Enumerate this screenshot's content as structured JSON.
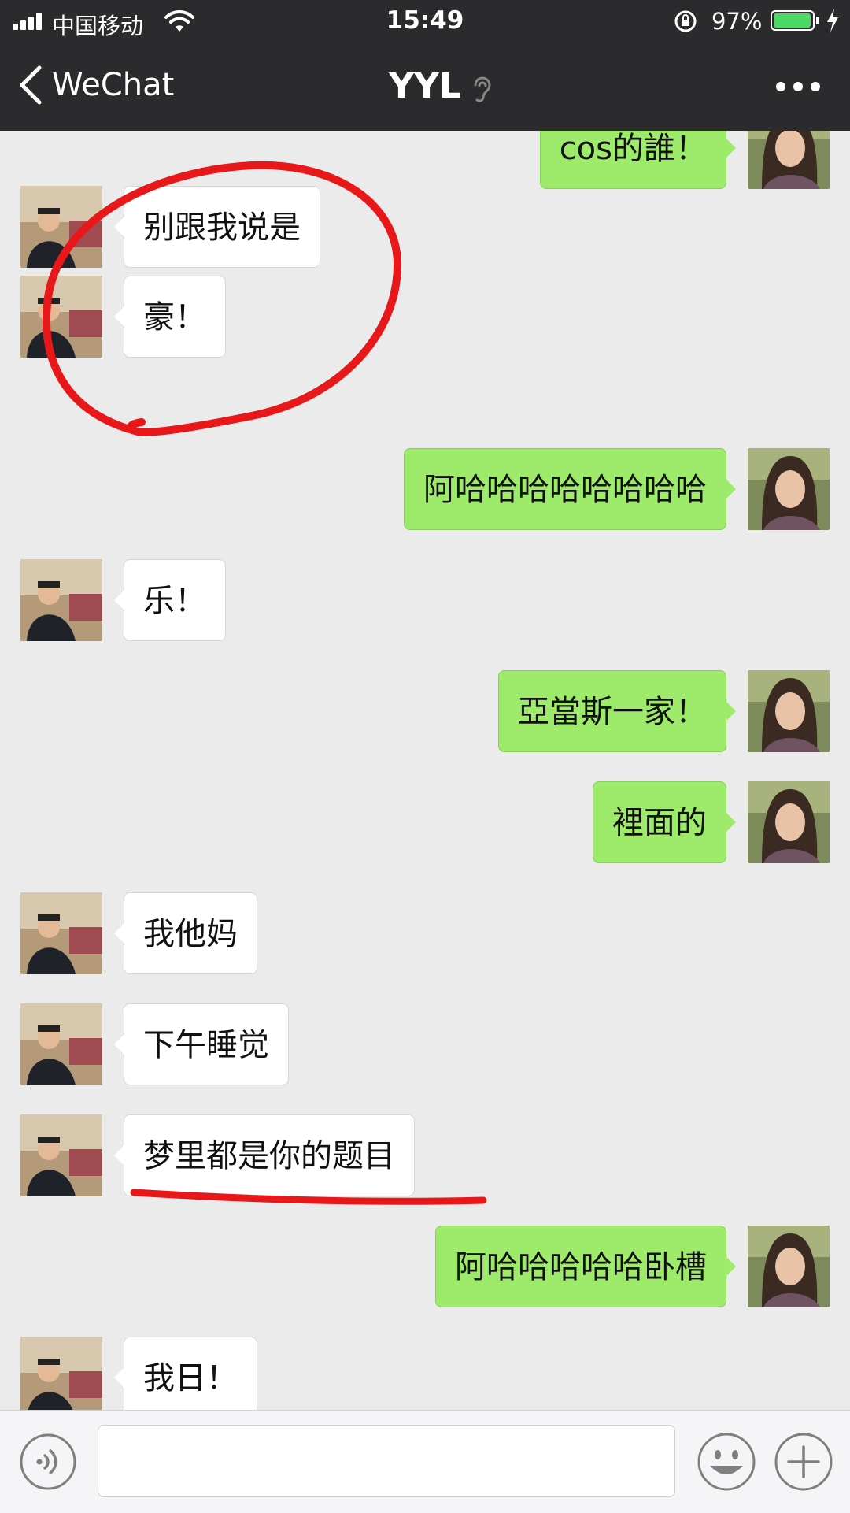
{
  "status_bar": {
    "carrier": "中国移动",
    "time": "15:49",
    "battery_percent": "97%",
    "battery_level": 0.97,
    "icons": [
      "signal-icon",
      "wifi-icon",
      "rotation-lock-icon",
      "battery-icon",
      "charging-icon"
    ]
  },
  "nav": {
    "back_label": "WeChat",
    "title": "YYL",
    "icons": [
      "chevron-left-icon",
      "ear-icon",
      "more-icon"
    ]
  },
  "messages": [
    {
      "side": "right",
      "text": "cos的誰！"
    },
    {
      "side": "left",
      "text": "别跟我说是"
    },
    {
      "side": "left",
      "text": "豪！"
    },
    {
      "side": "right",
      "text": "阿哈哈哈哈哈哈哈哈"
    },
    {
      "side": "left",
      "text": "乐！"
    },
    {
      "side": "right",
      "text": "亞當斯一家！"
    },
    {
      "side": "right",
      "text": "裡面的"
    },
    {
      "side": "left",
      "text": "我他妈"
    },
    {
      "side": "left",
      "text": "下午睡觉"
    },
    {
      "side": "left",
      "text": "梦里都是你的题目"
    },
    {
      "side": "right",
      "text": "阿哈哈哈哈哈卧槽"
    },
    {
      "side": "left",
      "text": "我日！"
    }
  ],
  "input_bar": {
    "input_value": "",
    "icons": [
      "voice-icon",
      "emoji-icon",
      "plus-icon"
    ]
  },
  "colors": {
    "nav_background": "#2b2b2e",
    "chat_background": "#ebebeb",
    "sent_bubble": "#9eea6a",
    "received_bubble": "#ffffff",
    "annotation_red": "#e8181a"
  }
}
